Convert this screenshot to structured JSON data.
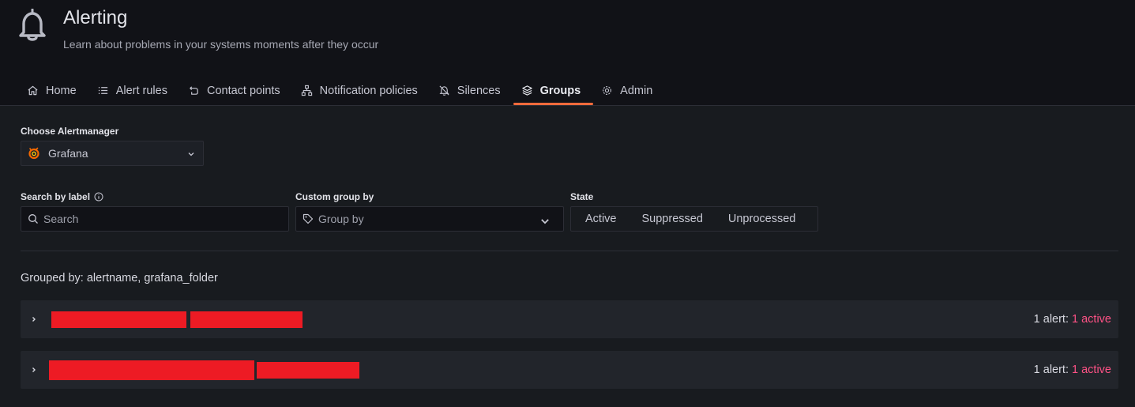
{
  "header": {
    "title": "Alerting",
    "subtitle": "Learn about problems in your systems moments after they occur",
    "icon": "bell-icon"
  },
  "tabs": [
    {
      "label": "Home",
      "icon": "home-icon",
      "active": false
    },
    {
      "label": "Alert rules",
      "icon": "list-icon",
      "active": false
    },
    {
      "label": "Contact points",
      "icon": "comment-alt-share-icon",
      "active": false
    },
    {
      "label": "Notification policies",
      "icon": "sitemap-icon",
      "active": false
    },
    {
      "label": "Silences",
      "icon": "bell-slash-icon",
      "active": false
    },
    {
      "label": "Groups",
      "icon": "layer-group-icon",
      "active": true
    },
    {
      "label": "Admin",
      "icon": "cog-icon",
      "active": false
    }
  ],
  "alertmanager": {
    "label": "Choose Alertmanager",
    "selected": "Grafana",
    "logo": "grafana-logo-icon"
  },
  "filters": {
    "search_label": "Search by label",
    "search_placeholder": "Search",
    "group_by_label": "Custom group by",
    "group_by_placeholder": "Group by",
    "state_label": "State",
    "states": [
      "Active",
      "Suppressed",
      "Unprocessed"
    ]
  },
  "grouped_by": "Grouped by: alertname, grafana_folder",
  "groups": [
    {
      "count_text": "1 alert: ",
      "active_text": "1 active"
    },
    {
      "count_text": "1 alert: ",
      "active_text": "1 active"
    }
  ],
  "colors": {
    "accent": "#f56b3c",
    "active": "#ff5286",
    "redaction": "#ed1b24"
  }
}
